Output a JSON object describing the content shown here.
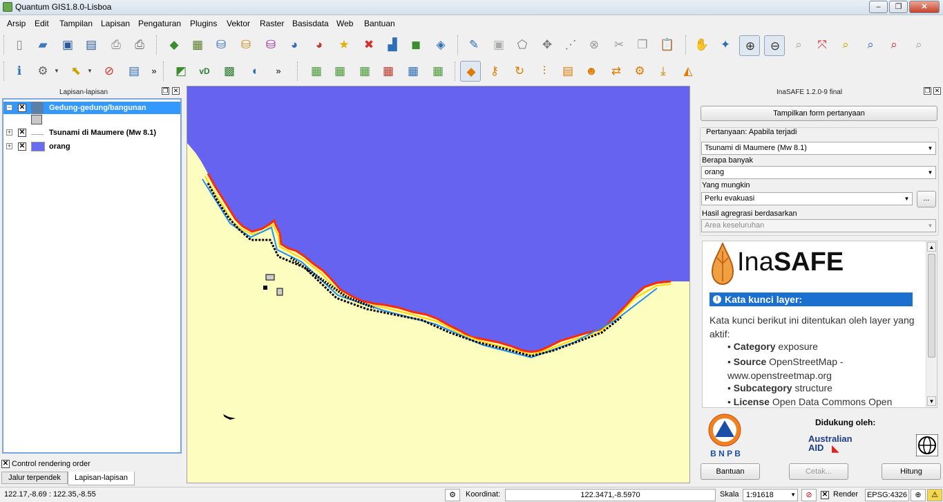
{
  "window": {
    "title": "Quantum GIS1.8.0-Lisboa",
    "minimize": "–",
    "restore": "❐",
    "close": "✕"
  },
  "menu": [
    "Arsip",
    "Edit",
    "Tampilan",
    "Lapisan",
    "Pengaturan",
    "Plugins",
    "Vektor",
    "Raster",
    "Basisdata",
    "Web",
    "Bantuan"
  ],
  "toolbar_overflow": "»",
  "layers_panel": {
    "title": "Lapisan-lapisan",
    "layers": [
      {
        "name": "Gedung-gedung/bangunan",
        "selected": true,
        "checked": "✕"
      },
      {
        "name": "Tsunami di Maumere (Mw 8.1)",
        "selected": false,
        "checked": "✕"
      },
      {
        "name": "orang",
        "selected": false,
        "checked": "✕"
      }
    ],
    "control_rendering_order": "Control rendering order",
    "tabs": [
      "Jalur terpendek",
      "Lapisan-lapisan"
    ]
  },
  "inasafe": {
    "title": "InaSAFE 1.2.0-9 final",
    "show_form_button": "Tampilkan form pertanyaan",
    "question_label": "Pertanyaan: Apabila terjadi",
    "hazard_value": "Tsunami di Maumere (Mw 8.1)",
    "how_many_label": "Berapa banyak",
    "exposure_value": "orang",
    "might_label": "Yang mungkin",
    "function_value": "Perlu evakuasi",
    "ellipsis": "...",
    "aggregation_label": "Hasil agregrasi berdasarkan",
    "aggregation_value": "Area keseluruhan",
    "logo_text_a": "Ina",
    "logo_text_b": "SAFE",
    "keywords_heading": "Kata kunci layer:",
    "keywords_intro": "Kata kunci berikut ini ditentukan oleh layer yang aktif:",
    "keywords": [
      {
        "key": "Category",
        "value": "exposure"
      },
      {
        "key": "Source",
        "value": "OpenStreetMap - www.openstreetmap.org"
      },
      {
        "key": "Subcategory",
        "value": "structure"
      },
      {
        "key": "License",
        "value": "Open Data Commons Open"
      }
    ],
    "supported_by": "Didukung oleh:",
    "bnpb": "B N P B",
    "aus_aid_1": "Australian",
    "aus_aid_2": "AID",
    "help_button": "Bantuan",
    "print_button": "Cetak...",
    "run_button": "Hitung"
  },
  "status": {
    "extent": "122.17,-8.69 : 122.35,-8.55",
    "coord_label": "Koordinat:",
    "coord_value": "122.3471,-8.5970",
    "scale_label": "Skala",
    "scale_value": "1:91618",
    "render_label": "Render",
    "epsg": "EPSG:4326"
  }
}
